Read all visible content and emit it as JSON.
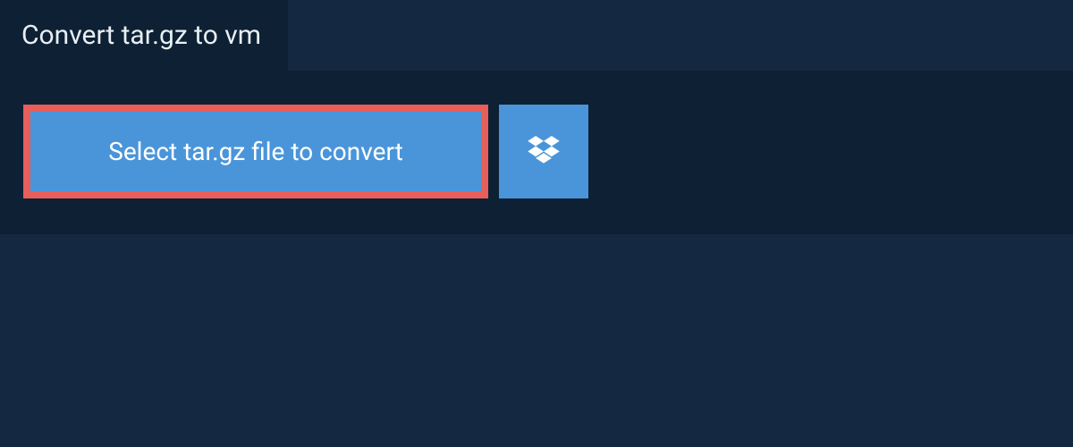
{
  "tab": {
    "title": "Convert tar.gz to vm"
  },
  "buttons": {
    "select_file_label": "Select tar.gz file to convert",
    "dropbox_icon_name": "dropbox-icon"
  },
  "colors": {
    "page_bg": "#142841",
    "panel_bg": "#0d2034",
    "button_bg": "#4a95d9",
    "highlight_border": "#e75e5a",
    "text_light": "#ffffff"
  }
}
